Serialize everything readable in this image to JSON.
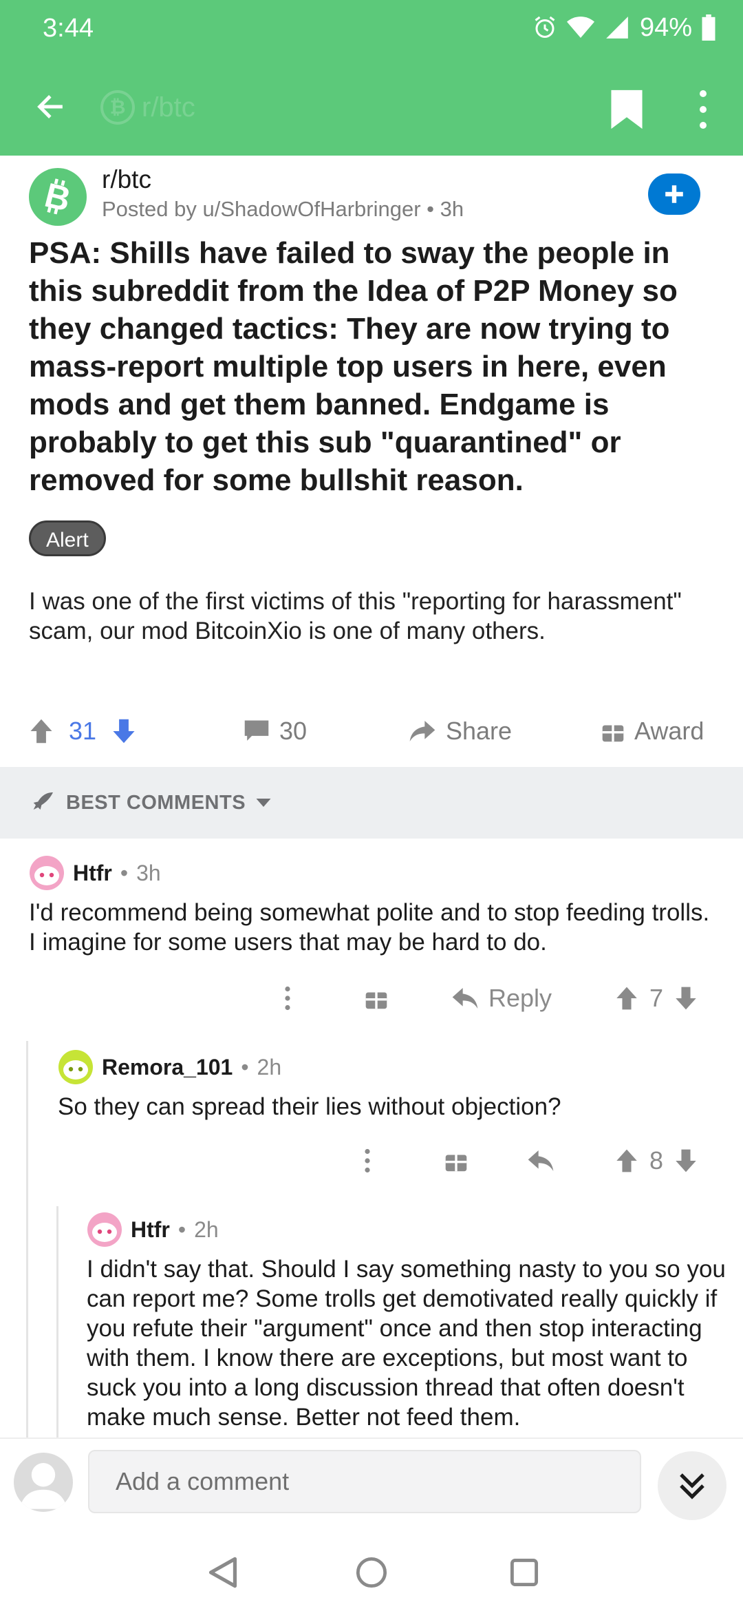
{
  "status_bar": {
    "time": "3:44",
    "battery": "94%",
    "icons": [
      "alarm-icon",
      "wifi-icon",
      "signal-icon",
      "battery-icon"
    ]
  },
  "app_bar": {
    "subreddit": "r/btc",
    "icons": [
      "back-arrow-icon",
      "bookmark-icon",
      "more-vertical-icon"
    ]
  },
  "colors": {
    "header_green": "#5cc97a",
    "join_blue": "#0079d3",
    "upvote_blue": "#4a78e6",
    "flair_gray": "#5d5d5d"
  },
  "post": {
    "subreddit": "r/btc",
    "posted_by": "Posted by u/ShadowOfHarbringer • 3h",
    "title": "PSA: Shills have failed to sway the people in this subreddit from the Idea of P2P Money so they changed tactics: They are now trying to mass-report multiple top users in here, even mods and get them banned. Endgame is probably to get this sub \"quarantined\" or removed for some bullshit reason.",
    "flair": "Alert",
    "body": "I was one of the first victims of this \"reporting for harassment\" scam, our mod BitcoinXio is one of many others.",
    "votes": "31",
    "comments": "30",
    "share_label": "Share",
    "award_label": "Award"
  },
  "sort": {
    "label": "BEST COMMENTS"
  },
  "comments": [
    {
      "user": "Htfr",
      "time": "3h",
      "body": "I'd recommend being somewhat polite and to stop feeding trolls. I imagine for some users that may be hard to do.",
      "reply_label": "Reply",
      "votes": "7"
    },
    {
      "user": "Remora_101",
      "time": "2h",
      "body": "So they can spread their lies without objection?",
      "votes": "8"
    },
    {
      "user": "Htfr",
      "time": "2h",
      "body": "I didn't say that. Should I say something nasty to you so you can report me? Some trolls get demotivated really quickly if you refute their \"argument\" once and then stop interacting with them.  I know there are exceptions, but most want to suck you into a long discussion thread that often doesn't make much sense. Better not feed them."
    }
  ],
  "composer": {
    "placeholder": "Add a comment"
  },
  "separator": "•"
}
